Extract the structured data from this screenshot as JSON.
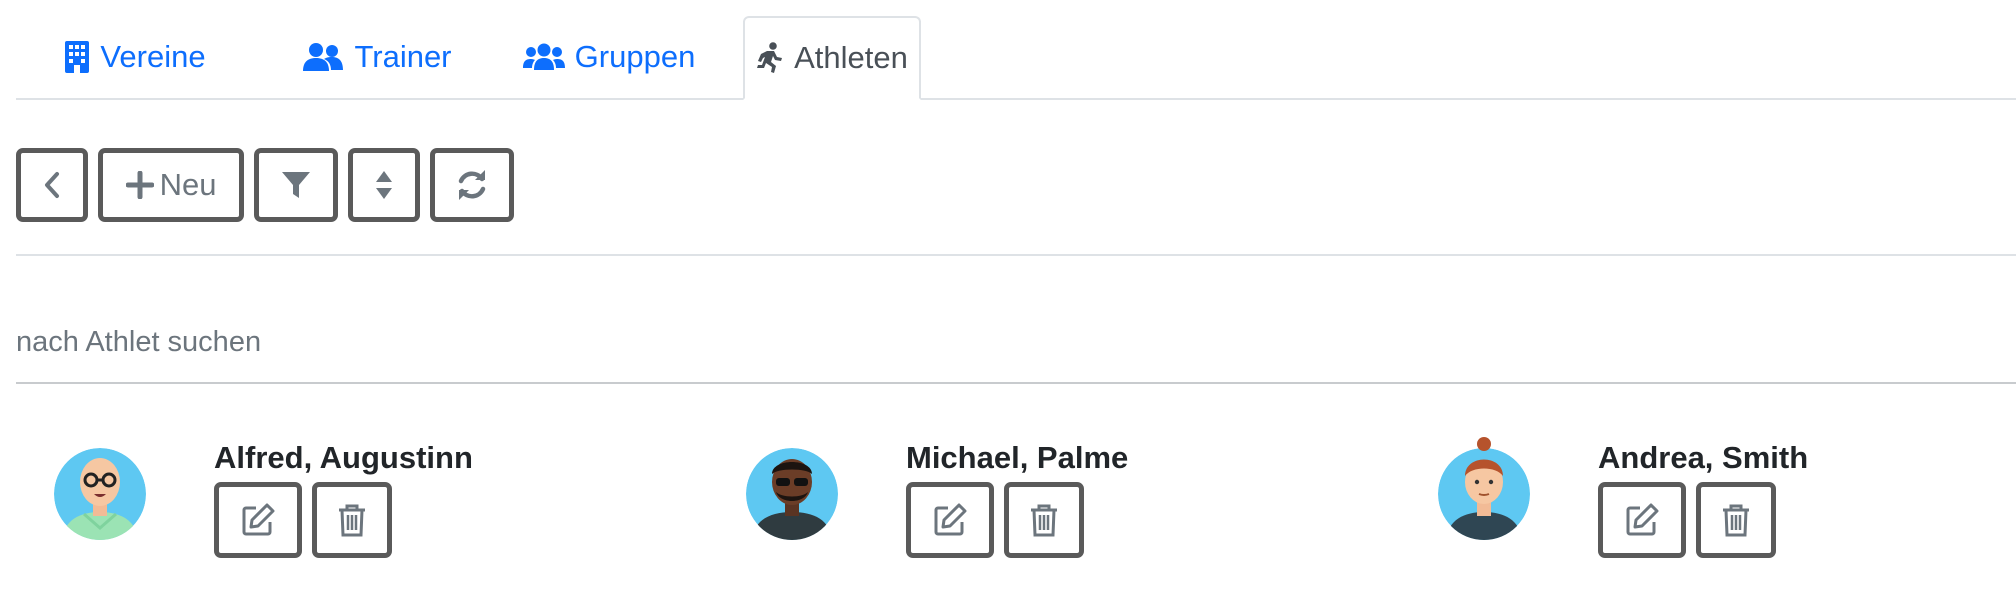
{
  "tabs": [
    {
      "label": "Vereine",
      "icon": "building-icon"
    },
    {
      "label": "Trainer",
      "icon": "users-icon"
    },
    {
      "label": "Gruppen",
      "icon": "user-group-icon"
    },
    {
      "label": "Athleten",
      "icon": "running-icon"
    }
  ],
  "active_tab": "Athleten",
  "toolbar": {
    "new_label": "Neu",
    "icons": [
      "chevron-left-icon",
      "plus-icon",
      "filter-icon",
      "sort-icon",
      "sync-icon"
    ]
  },
  "search": {
    "placeholder": "nach Athlet suchen",
    "value": ""
  },
  "athletes": [
    {
      "name": "Alfred, Augustinn"
    },
    {
      "name": "Michael, Palme"
    },
    {
      "name": "Andrea, Smith"
    }
  ],
  "colors": {
    "link": "#0d6efd",
    "active_tab_text": "#495057",
    "button_border": "#5a5a5a",
    "avatar_bg": "#5ec8f2"
  }
}
